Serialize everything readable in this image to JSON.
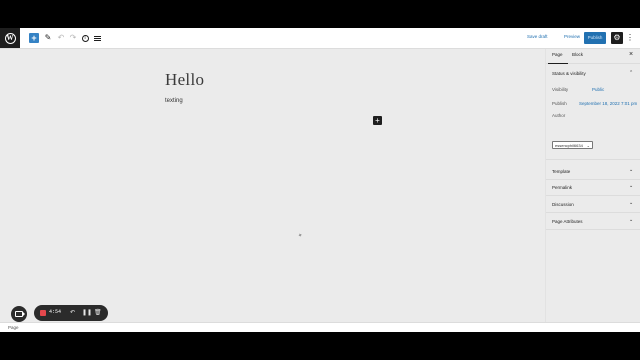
{
  "toolbar": {
    "save_draft": "Save draft",
    "preview": "Preview",
    "publish": "Publish",
    "add_icon": "+",
    "settings_icon": "⚙",
    "more_icon": "⋮"
  },
  "editor": {
    "title": "Hello",
    "paragraph": "texting",
    "add_block_icon": "+"
  },
  "sidebar": {
    "tabs": [
      "Page",
      "Block"
    ],
    "close_icon": "×",
    "status_panel": {
      "heading": "Status & visibility",
      "visibility_label": "Visibility",
      "visibility_value": "Public",
      "publish_label": "Publish",
      "publish_value": "September 18, 2022 7:01 pm",
      "author_label": "Author",
      "author_value": "essencphil6634"
    },
    "panels": [
      "Template",
      "Permalink",
      "Discussion",
      "Page Attributes"
    ]
  },
  "statusbar": {
    "breadcrumb": "Page"
  },
  "recorder": {
    "time": "4:54",
    "stop_color": "#e5484d"
  },
  "colors": {
    "accent": "#2271b1",
    "dark": "#1e1e1e"
  }
}
